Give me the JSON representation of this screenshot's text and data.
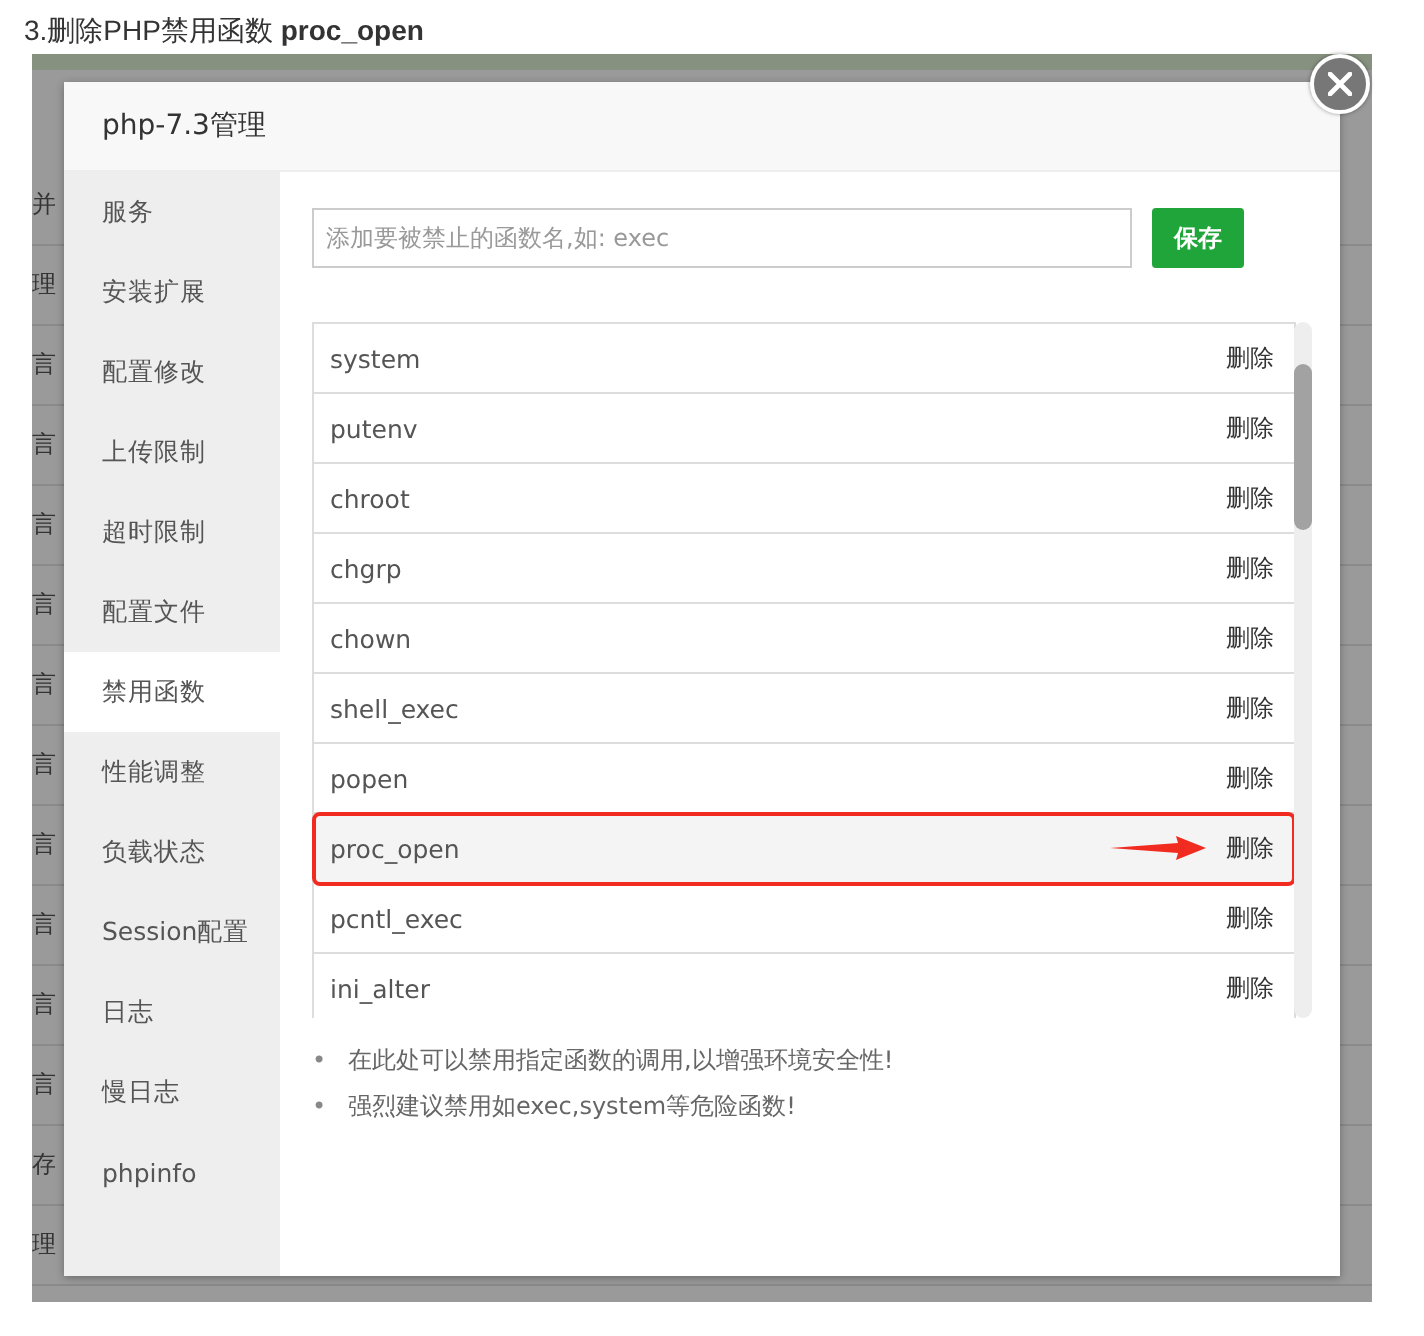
{
  "caption": "3.删除PHP禁用函数 **proc_open**",
  "background_rows": [
    "并",
    "理",
    "言",
    "言",
    "言",
    "言",
    "言",
    "言",
    "言",
    "言",
    "言",
    "言",
    "存",
    "理"
  ],
  "dialog": {
    "title": "php-7.3管理",
    "sidebar": [
      {
        "label": "服务",
        "selected": false
      },
      {
        "label": "安装扩展",
        "selected": false
      },
      {
        "label": "配置修改",
        "selected": false
      },
      {
        "label": "上传限制",
        "selected": false
      },
      {
        "label": "超时限制",
        "selected": false
      },
      {
        "label": "配置文件",
        "selected": false
      },
      {
        "label": "禁用函数",
        "selected": true
      },
      {
        "label": "性能调整",
        "selected": false
      },
      {
        "label": "负载状态",
        "selected": false
      },
      {
        "label": "Session配置",
        "selected": false
      },
      {
        "label": "日志",
        "selected": false
      },
      {
        "label": "慢日志",
        "selected": false
      },
      {
        "label": "phpinfo",
        "selected": false
      }
    ],
    "input": {
      "placeholder": "添加要被禁止的函数名,如: exec"
    },
    "save_button": "保存",
    "functions": [
      {
        "name": "system",
        "action": "删除",
        "highlighted": false
      },
      {
        "name": "putenv",
        "action": "删除",
        "highlighted": false
      },
      {
        "name": "chroot",
        "action": "删除",
        "highlighted": false
      },
      {
        "name": "chgrp",
        "action": "删除",
        "highlighted": false
      },
      {
        "name": "chown",
        "action": "删除",
        "highlighted": false
      },
      {
        "name": "shell_exec",
        "action": "删除",
        "highlighted": false
      },
      {
        "name": "popen",
        "action": "删除",
        "highlighted": false
      },
      {
        "name": "proc_open",
        "action": "删除",
        "highlighted": true
      },
      {
        "name": "pcntl_exec",
        "action": "删除",
        "highlighted": false
      },
      {
        "name": "ini_alter",
        "action": "删除",
        "highlighted": false
      }
    ],
    "notes": [
      {
        "bullet": "•",
        "text": "在此处可以禁用指定函数的调用,以增强环境安全性!"
      },
      {
        "bullet": "•",
        "text": "强烈建议禁用如exec,system等危险函数!"
      }
    ]
  }
}
